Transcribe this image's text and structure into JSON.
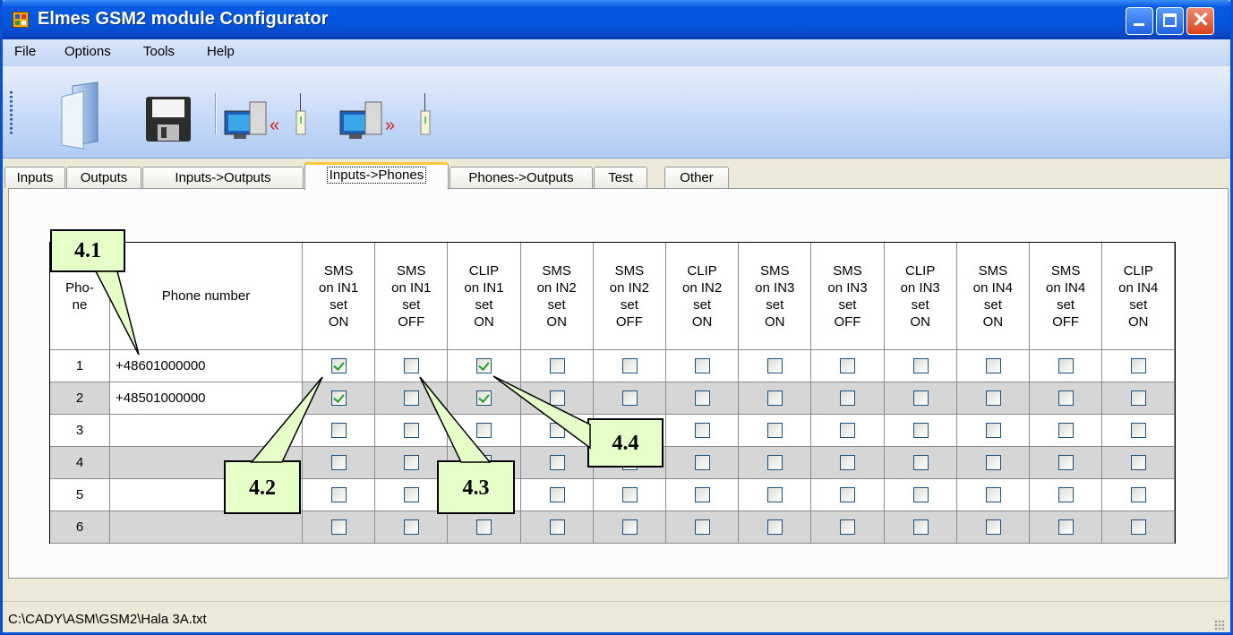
{
  "window": {
    "title": "Elmes GSM2 module Configurator"
  },
  "menu": [
    "File",
    "Options",
    "Tools",
    "Help"
  ],
  "toolbar": {
    "icons": [
      "open-document-icon",
      "save-disk-icon",
      "read-from-module-icon",
      "write-to-module-icon"
    ]
  },
  "tabs": [
    "Inputs",
    "Outputs",
    "Inputs->Outputs",
    "Inputs->Phones",
    "Phones->Outputs",
    "Test",
    "Other"
  ],
  "active_tab": "Inputs->Phones",
  "grid": {
    "col_phone": "Pho-\nne",
    "col_number": "Phone number",
    "columns": [
      "SMS\non IN1\nset\nON",
      "SMS\non IN1\nset\nOFF",
      "CLIP\non IN1\nset\nON",
      "SMS\non IN2\nset\nON",
      "SMS\non IN2\nset\nOFF",
      "CLIP\non IN2\nset\nON",
      "SMS\non IN3\nset\nON",
      "SMS\non IN3\nset\nOFF",
      "CLIP\non IN3\nset\nON",
      "SMS\non IN4\nset\nON",
      "SMS\non IN4\nset\nOFF",
      "CLIP\non IN4\nset\nON"
    ],
    "rows": [
      {
        "num": "1",
        "phone": "+48601000000",
        "checks": [
          true,
          false,
          true,
          false,
          false,
          false,
          false,
          false,
          false,
          false,
          false,
          false
        ]
      },
      {
        "num": "2",
        "phone": "+48501000000",
        "checks": [
          true,
          false,
          true,
          false,
          false,
          false,
          false,
          false,
          false,
          false,
          false,
          false
        ]
      },
      {
        "num": "3",
        "phone": "",
        "checks": [
          false,
          false,
          false,
          false,
          false,
          false,
          false,
          false,
          false,
          false,
          false,
          false
        ]
      },
      {
        "num": "4",
        "phone": "",
        "checks": [
          false,
          false,
          false,
          false,
          false,
          false,
          false,
          false,
          false,
          false,
          false,
          false
        ]
      },
      {
        "num": "5",
        "phone": "",
        "checks": [
          false,
          false,
          false,
          false,
          false,
          false,
          false,
          false,
          false,
          false,
          false,
          false
        ]
      },
      {
        "num": "6",
        "phone": "",
        "checks": [
          false,
          false,
          false,
          false,
          false,
          false,
          false,
          false,
          false,
          false,
          false,
          false
        ]
      }
    ]
  },
  "callouts": [
    "4.1",
    "4.2",
    "4.3",
    "4.4"
  ],
  "status": {
    "path": "C:\\CADY\\ASM\\GSM2\\Hala 3A.txt"
  }
}
